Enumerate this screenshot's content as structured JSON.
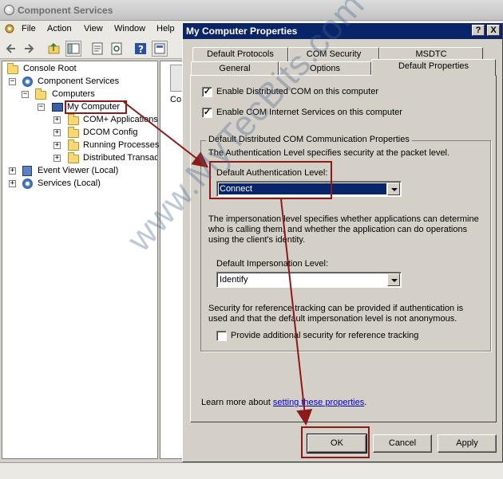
{
  "background_window": {
    "title": "Component Services",
    "menu": [
      "File",
      "Action",
      "View",
      "Window",
      "Help"
    ],
    "tree": {
      "console_root": "Console Root",
      "component_services": "Component Services",
      "computers": "Computers",
      "my_computer": "My Computer",
      "com_plus": "COM+ Applications",
      "dcom_config": "DCOM Config",
      "running_processes": "Running Processes",
      "distributed_transactions": "Distributed Transaco",
      "event_viewer": "Event Viewer (Local)",
      "services": "Services (Local)"
    },
    "result_pane_label": "Co"
  },
  "dialog": {
    "title": "My Computer Properties",
    "help_button": "?",
    "close_button": "X",
    "tabs_row1": [
      "Default Protocols",
      "COM Security",
      "MSDTC"
    ],
    "tabs_row2": [
      "General",
      "Options",
      "Default Properties"
    ],
    "active_tab": "Default Properties",
    "enable_dcom": {
      "label": "Enable Distributed COM on this computer",
      "checked": true
    },
    "enable_com_internet": {
      "label": "Enable COM Internet Services on this computer",
      "checked": true
    },
    "group_title": "Default Distributed COM Communication Properties",
    "auth_description": "The Authentication Level specifies security at the packet level.",
    "auth_level_label": "Default Authentication Level:",
    "auth_level_value": "Connect",
    "impersonation_description": "The impersonation level specifies whether applications can determine who is calling them, and whether the application can do operations using the client's identity.",
    "impersonation_level_label": "Default Impersonation Level:",
    "impersonation_level_value": "Identify",
    "reference_tracking_description": "Security for reference tracking can be provided if authentication is used and that the default impersonation level is not anonymous.",
    "reference_tracking": {
      "label": "Provide additional security for reference tracking",
      "checked": false
    },
    "learn_more_prefix": "Learn more about ",
    "learn_more_link": "setting these properties",
    "learn_more_suffix": ".",
    "buttons": {
      "ok": "OK",
      "cancel": "Cancel",
      "apply": "Apply"
    }
  },
  "watermark": "www.MyTecBits.com",
  "annotation_color": "#8b1a1a"
}
